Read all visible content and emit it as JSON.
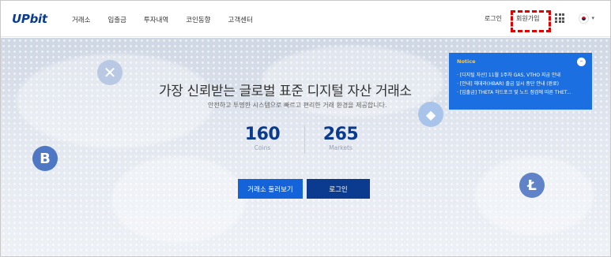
{
  "header": {
    "logo": "UPbit",
    "nav": [
      "거래소",
      "입출금",
      "투자내역",
      "코인동향",
      "고객센터"
    ],
    "login": "로그인",
    "signup": "회원가입",
    "grid_icon": "app-grid-icon",
    "flag_icon": "korea-flag-icon",
    "chevron": "▾"
  },
  "hero": {
    "title": "가장 신뢰받는 글로벌 표준 디지털 자산 거래소",
    "subtitle": "안전하고 투명한 시스템으로 빠르고 편리한 거래 환경을 제공합니다.",
    "stats": [
      {
        "value": "160",
        "label": "Coins"
      },
      {
        "value": "265",
        "label": "Markets"
      }
    ],
    "buttons": {
      "explore": "거래소 둘러보기",
      "login": "로그인"
    },
    "coins": [
      "x-coin-icon",
      "ethereum-icon",
      "bitcoin-icon",
      "litecoin-icon"
    ]
  },
  "notice": {
    "title": "Notice",
    "close_icon": "minus-circle-icon",
    "items": [
      "· [디지털 자산] 11월 1주차 GAS, VTHO 지급 안내",
      "· [안내] 헤데라(HBAR) 출금 일시 중단 안내 (완료)",
      "· [입출금] THETA 하드포크 및 노드 점검에 따른 THET..."
    ]
  },
  "colors": {
    "brand": "#0b3b8f",
    "accent": "#1463d8",
    "notice_bg": "#1b6fe0",
    "notice_title": "#ffc83d",
    "highlight": "#e00000"
  }
}
